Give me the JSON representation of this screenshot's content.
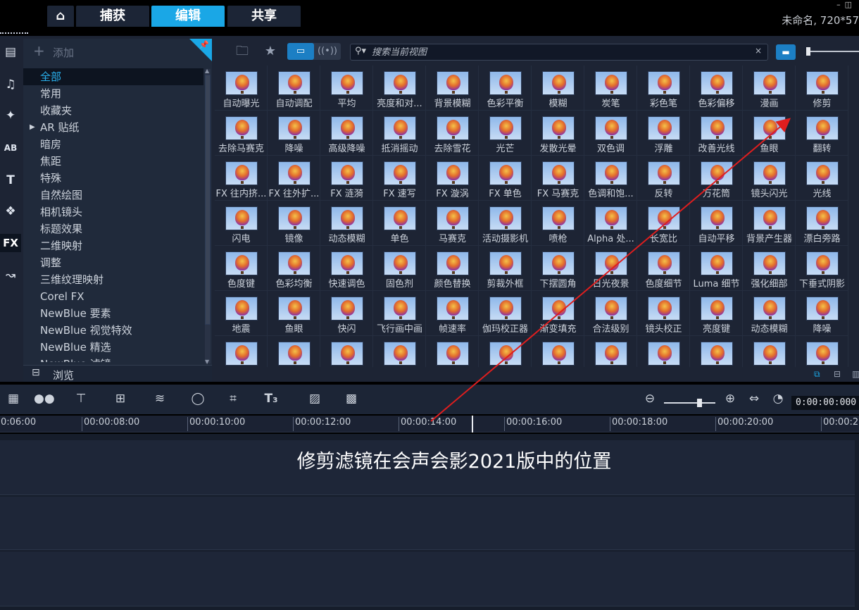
{
  "tabs": [
    {
      "label": "⌂",
      "name": "home"
    },
    {
      "label": "捕获",
      "name": "capture"
    },
    {
      "label": "编辑",
      "name": "edit",
      "active": true
    },
    {
      "label": "共享",
      "name": "share"
    }
  ],
  "project_title": "未命名, 720*57",
  "library": {
    "add_label": "添加",
    "browse_label": "浏览",
    "categories": [
      "全部",
      "常用",
      "收藏夹",
      "AR 贴纸",
      "暗房",
      "焦距",
      "特殊",
      "自然绘图",
      "相机镜头",
      "标题效果",
      "二维映射",
      "调整",
      "三维纹理映射",
      "Corel FX",
      "NewBlue 要素",
      "NewBlue 视觉特效",
      "NewBlue 精选",
      "NewBlue 滤镜"
    ],
    "selected_category": "全部",
    "search_placeholder": "搜索当前视图"
  },
  "filters": [
    "自动曝光",
    "自动调配",
    "平均",
    "亮度和对...",
    "背景模糊",
    "色彩平衡",
    "模糊",
    "炭笔",
    "彩色笔",
    "色彩偏移",
    "漫画",
    "修剪",
    "去除马赛克",
    "降噪",
    "高级降噪",
    "抵消摇动",
    "去除雪花",
    "光芒",
    "发散光晕",
    "双色调",
    "浮雕",
    "改善光线",
    "鱼眼",
    "翻转",
    "FX 往内挤...",
    "FX 往外扩...",
    "FX 涟漪",
    "FX 速写",
    "FX 漩涡",
    "FX 单色",
    "FX 马赛克",
    "色调和饱...",
    "反转",
    "万花筒",
    "镜头闪光",
    "光线",
    "闪电",
    "镜像",
    "动态模糊",
    "单色",
    "马赛克",
    "活动摄影机",
    "喷枪",
    "Alpha 处...",
    "长宽比",
    "自动平移",
    "背景产生器",
    "漂白旁路",
    "色度键",
    "色彩均衡",
    "快速调色",
    "固色剂",
    "颜色替换",
    "剪裁外框",
    "下摆圆角",
    "日光夜景",
    "色度细节",
    "Luma 细节",
    "强化细部",
    "下垂式阴影",
    "地震",
    "鱼眼",
    "快闪",
    "飞行画中画",
    "帧速率",
    "伽玛校正器",
    "渐变填充",
    "合法级别",
    "镜头校正",
    "亮度键",
    "动态模糊",
    "降噪",
    "",
    "",
    "",
    "",
    "",
    "",
    "",
    "",
    "",
    "",
    "",
    ""
  ],
  "timeline": {
    "timecode": "0:00:00:000",
    "ruler": [
      "0:06:00",
      "00:00:08:00",
      "00:00:10:00",
      "00:00:12:00",
      "00:00:14:00",
      "00:00:16:00",
      "00:00:18:00",
      "00:00:20:00",
      "00:00:2"
    ]
  },
  "annotation": "修剪滤镜在会声会影2021版中的位置",
  "colors": {
    "accent": "#1aa7e6",
    "arrow": "#e01e1e"
  }
}
